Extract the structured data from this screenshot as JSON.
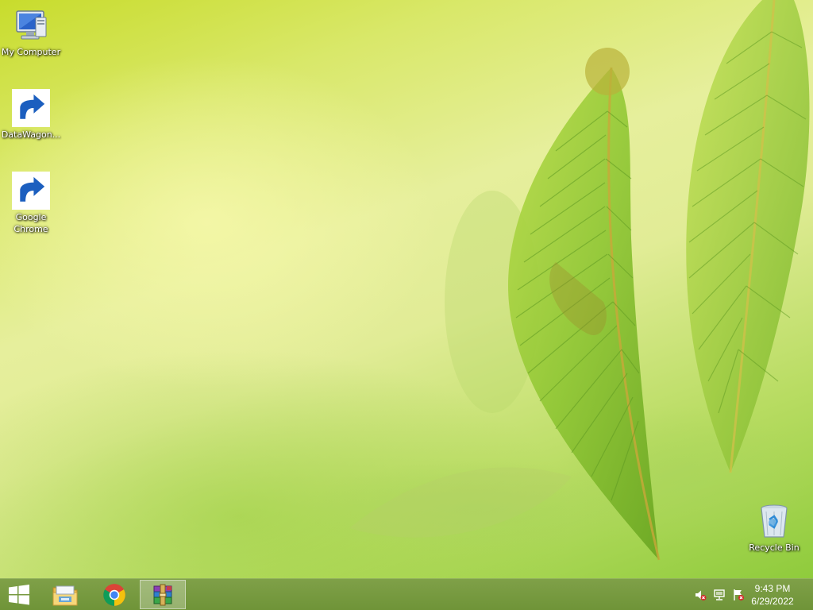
{
  "desktop": {
    "icons": [
      {
        "label": "My Computer",
        "icon": "my-computer-icon"
      },
      {
        "label": "DataWagon...",
        "icon": "datawagon-icon"
      },
      {
        "label": "Google Chrome",
        "icon": "chrome-icon"
      },
      {
        "label": "Recycle Bin",
        "icon": "recycle-bin-icon"
      }
    ]
  },
  "taskbar": {
    "start_icon": "windows-logo-icon",
    "pinned": [
      {
        "icon": "file-explorer-icon"
      },
      {
        "icon": "chrome-icon"
      },
      {
        "icon": "winrar-icon"
      }
    ],
    "tray": {
      "icons": [
        "volume-muted-icon",
        "network-icon",
        "action-center-icon"
      ],
      "time": "9:43 PM",
      "date": "6/29/2022"
    }
  },
  "colors": {
    "taskbar": "#76993f",
    "wallpaper_accent": "#d9e86a"
  }
}
